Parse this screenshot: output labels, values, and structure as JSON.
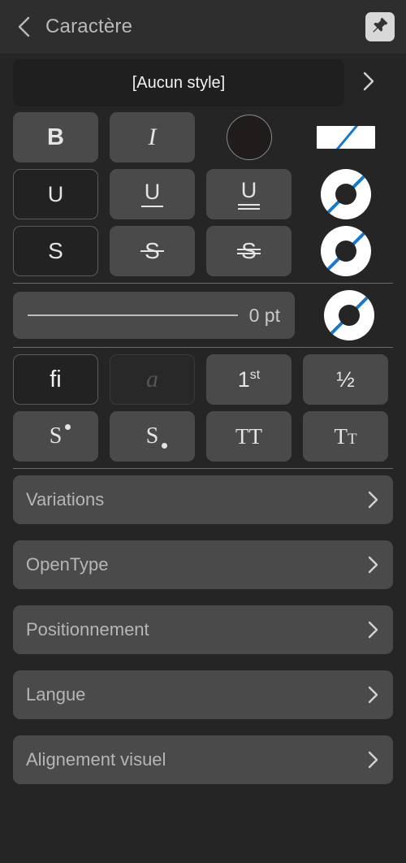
{
  "header": {
    "title": "Caractère",
    "back_icon": "chevron-left-icon",
    "pin_icon": "pin-icon"
  },
  "style_selector": {
    "label": "[Aucun style]",
    "chevron_icon": "chevron-right-icon"
  },
  "format_row": {
    "bold_label": "B",
    "italic_label": "I",
    "text_color_swatch": "#201c1c",
    "none_swatch_stripe": "#1878d0"
  },
  "underline_row": {
    "single_label": "U",
    "double_label": "U",
    "thick_label": "U",
    "swatch": "donut-swatch"
  },
  "strikethrough_row": {
    "plain_label": "S",
    "single_label": "S",
    "double_label": "S",
    "swatch": "donut-swatch"
  },
  "stroke_row": {
    "value": "0 pt",
    "swatch": "donut-swatch"
  },
  "typography_row": {
    "ligature_label": "fi",
    "swash_label": "a",
    "ordinal_number": "1",
    "ordinal_suffix": "st",
    "fraction_label": "½"
  },
  "case_row": {
    "superscript_label": "S",
    "subscript_label": "S",
    "allcaps_label": "TT",
    "smallcaps_label": "T",
    "smallcaps_small": "T"
  },
  "list": {
    "items": [
      {
        "label": "Variations",
        "chevron_icon": "chevron-right-icon"
      },
      {
        "label": "OpenType",
        "chevron_icon": "chevron-right-icon"
      },
      {
        "label": "Positionnement",
        "chevron_icon": "chevron-right-icon"
      },
      {
        "label": "Langue",
        "chevron_icon": "chevron-right-icon"
      },
      {
        "label": "Alignement visuel",
        "chevron_icon": "chevron-right-icon"
      }
    ]
  },
  "colors": {
    "background": "#252525",
    "header_background": "#2e2e2e",
    "button": "#4a4a4a",
    "button_selected": "#222222",
    "accent_blue": "#1878d0",
    "text": "#b6b6b6"
  }
}
